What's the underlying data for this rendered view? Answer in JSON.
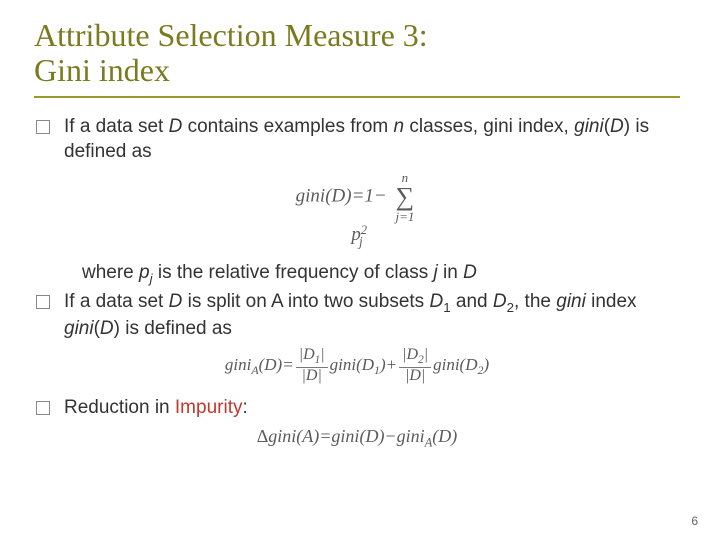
{
  "title_line1": "Attribute Selection Measure 3:",
  "title_line2": "Gini index",
  "bullets": {
    "b1_pre": "If a data set ",
    "b1_D": "D",
    "b1_mid1": " contains examples from ",
    "b1_n": "n",
    "b1_mid2": " classes, gini index, ",
    "b1_giniD": "gini",
    "b1_Dparen": "D",
    "b1_tail": ") is defined as",
    "where_pre": "where ",
    "where_p": "p",
    "where_j1": "j",
    "where_mid": " is the relative frequency of class ",
    "where_j2": "j",
    "where_in": " in ",
    "where_D": "D",
    "b2_pre": "If a data set ",
    "b2_D": "D",
    "b2_mid1": "  is split on A into two subsets ",
    "b2_D1": "D",
    "b2_sub1": "1",
    "b2_and": " and ",
    "b2_D2": "D",
    "b2_sub2": "2",
    "b2_mid2": ", the ",
    "b2_gini_i": "gini",
    "b2_mid3": " index ",
    "b2_gini2": "gini",
    "b2_D3": "D",
    "b2_tail": ") is defined as",
    "b3_pre": "Reduction in ",
    "b3_imp": "Impurity",
    "b3_colon": ":"
  },
  "formulas": {
    "f1_lhs": "gini",
    "f1_D": "D",
    "f1_eq": ")=1−",
    "f1_sum_top": "n",
    "f1_sigma": "∑",
    "f1_sum_bot": "j=1",
    "f1_p": "p",
    "f1_j": "j",
    "f1_sq": "2",
    "f2_lhs": "gini",
    "f2_A": "A",
    "f2_D": "D",
    "f2_eq": ")=",
    "f2_n1": "|D",
    "f2_n1s": "1",
    "f2_n1b": "|",
    "f2_den": "|D|",
    "f2_g1": "gini",
    "f2_D1": "D",
    "f2_s1": "1",
    "f2_plus": ")+",
    "f2_n2": "|D",
    "f2_n2s": "2",
    "f2_n2b": "|",
    "f2_g2": "gini",
    "f2_D2": "D",
    "f2_s2": "2",
    "f2_end": ")",
    "f3_delta": "Δ",
    "f3_g": "gini",
    "f3_A": "A",
    "f3_eq": ")=",
    "f3_gD": "gini",
    "f3_D": "D",
    "f3_minus": ")−",
    "f3_gA": "gini",
    "f3_As": "A",
    "f3_D2": "D",
    "f3_end": ")"
  },
  "page_number": "6"
}
